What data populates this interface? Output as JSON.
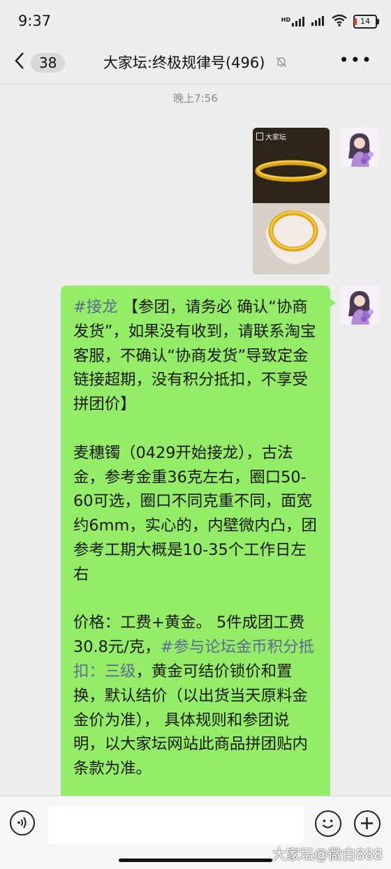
{
  "status_bar": {
    "time": "9:37",
    "network_label": "HD",
    "battery_level": "14",
    "icons": [
      "hd-signal-icon",
      "signal-icon",
      "wifi-icon",
      "battery-icon"
    ]
  },
  "nav": {
    "back_icon": "chevron-left-icon",
    "unread_count": "38",
    "title": "大家坛:终极规律号(496)",
    "mute_icon": "bell-muted-icon",
    "more_label": "•••"
  },
  "chat": {
    "timestamp": "晚上7:56",
    "image_message": {
      "logo_text": "大家坛",
      "content": "gold-bangle-photos"
    },
    "text_message": {
      "tag1": "#接龙",
      "p1_rest": " 【参团，请务必 确认“协商发货”，如果没有收到，请联系淘宝客服，不确认“协商发货”导致定金链接超期，没有积分抵扣，不享受拼团价】",
      "p2": "麦穗镯（0429开始接龙），古法金，参考金重36克左右，圈口50-60可选，圈口不同克重不同，面宽约6mm，实心的，内壁微内凸，团参考工期大概是10-35个工作日左右",
      "p3_before": "价格：工费+黄金。 5件成团工费30.8元/克，",
      "tag2": "#参与论坛金币积分抵扣：三级",
      "p3_after": "，黄金可结价锁价和置换，默认结价（以出货当天原料金金价为准）， 具体规则和参团说明，以大家坛网站此商品拼团贴内条款为准。"
    }
  },
  "input_bar": {
    "voice_icon": "voice-icon",
    "emoji_icon": "emoji-icon",
    "plus_icon": "plus-icon"
  },
  "watermark": "大家坛@微白888",
  "colors": {
    "bubble": "#95ec69",
    "background": "#ededed",
    "tag": "#5b6b92"
  }
}
